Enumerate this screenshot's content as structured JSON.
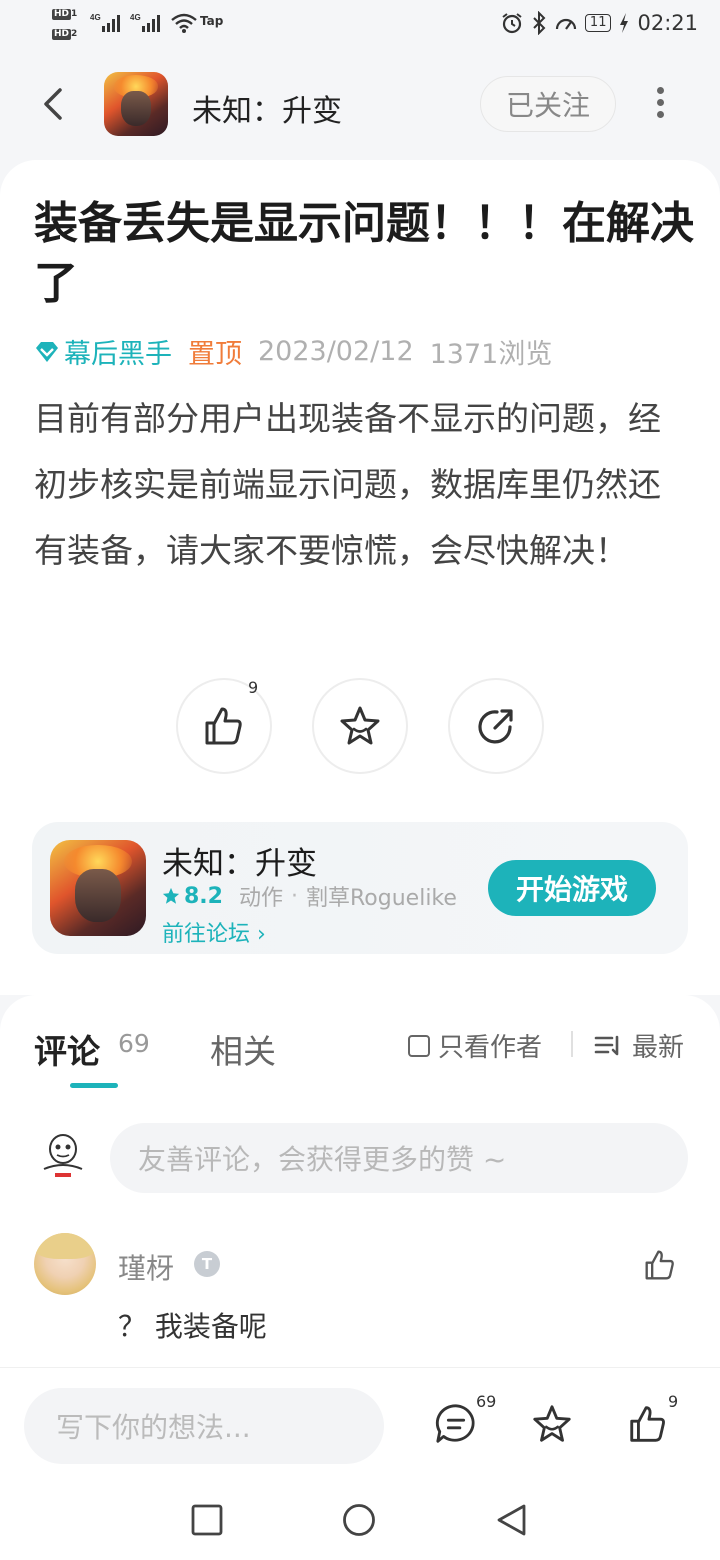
{
  "status_bar": {
    "hd1": "HD",
    "hd1_num": "1",
    "hd2": "HD",
    "hd2_num": "2",
    "net1": "4G",
    "net2": "4G",
    "tap": "Tap",
    "battery": "11",
    "time": "02:21"
  },
  "header": {
    "game_name": "未知：升变",
    "follow_label": "已关注"
  },
  "article": {
    "title": "装备丢失是显示问题！！！在解决了",
    "author": "幕后黑手",
    "pinned": "置顶",
    "date": "2023/02/12",
    "views": "1371浏览",
    "body": "目前有部分用户出现装备不显示的问题，经初步核实是前端显示问题，数据库里仍然还有装备，请大家不要惊慌，会尽快解决！",
    "like_count": "9"
  },
  "game_card": {
    "name": "未知：升变",
    "rating": "8.2",
    "genre1": "动作",
    "genre2": "割草Roguelike",
    "forum_link": "前往论坛 ›",
    "play_label": "开始游戏"
  },
  "comments_section": {
    "tab_comments": "评论",
    "tab_comments_count": "69",
    "tab_related": "相关",
    "author_only": "只看作者",
    "sort": "最新",
    "input_placeholder": "友善评论，会获得更多的赞 ~",
    "comments": [
      {
        "user": "瑾枒",
        "badge": "T",
        "text": "？ 我装备呢"
      }
    ]
  },
  "bottom_bar": {
    "placeholder": "写下你的想法...",
    "comment_count": "69",
    "like_count": "9"
  },
  "colors": {
    "accent": "#1db3ba",
    "pinned": "#f07c3a",
    "meta_gray": "#b0b0b0"
  },
  "icons": [
    "back-icon",
    "more-icon",
    "diamond-icon",
    "like-icon",
    "star-icon",
    "share-icon",
    "rating-star-icon",
    "checkbox-icon",
    "sort-icon",
    "comment-icon",
    "android-back-icon",
    "android-home-icon",
    "android-recent-icon"
  ]
}
